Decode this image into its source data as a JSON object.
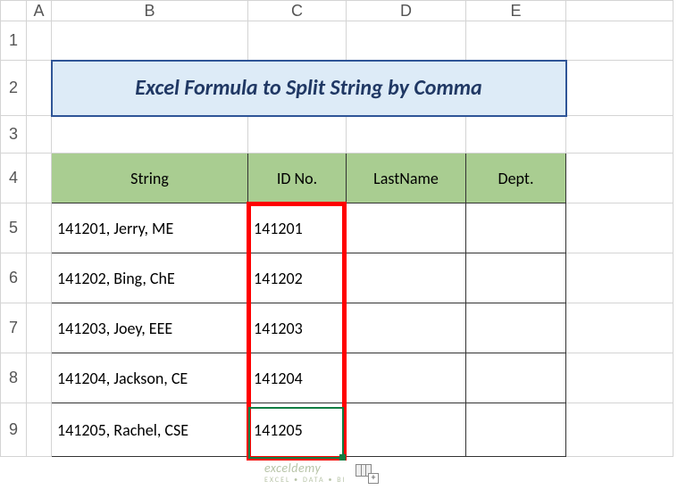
{
  "columns": [
    "A",
    "B",
    "C",
    "D",
    "E"
  ],
  "rows": [
    "1",
    "2",
    "3",
    "4",
    "5",
    "6",
    "7",
    "8",
    "9"
  ],
  "title": "Excel Formula to Split String by Comma",
  "headers": {
    "b": "String",
    "c": "ID No.",
    "d": "LastName",
    "e": "Dept."
  },
  "data": [
    {
      "string": "141201, Jerry, ME",
      "id": "141201",
      "last": "",
      "dept": ""
    },
    {
      "string": "141202, Bing, ChE",
      "id": "141202",
      "last": "",
      "dept": ""
    },
    {
      "string": "141203, Joey, EEE",
      "id": "141203",
      "last": "",
      "dept": ""
    },
    {
      "string": "141204, Jackson, CE",
      "id": "141204",
      "last": "",
      "dept": ""
    },
    {
      "string": "141205, Rachel, CSE",
      "id": "141205",
      "last": "",
      "dept": ""
    }
  ],
  "watermark": {
    "brand": "exceldemy",
    "tagline": "EXCEL • DATA • BI"
  }
}
